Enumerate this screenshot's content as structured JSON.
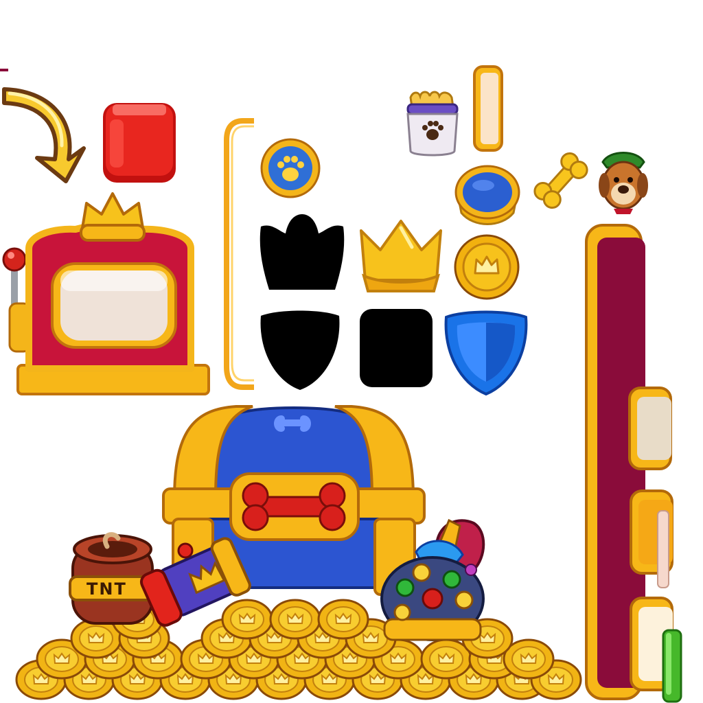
{
  "sheet": {
    "kind": "game-ui-sprite-atlas",
    "background": "#ffffff"
  },
  "sprites": [
    {
      "name": "curved-arrow-icon",
      "color": "#f7c92e"
    },
    {
      "name": "red-cube-icon",
      "color": "#e0201c"
    },
    {
      "name": "slot-machine-frame",
      "color": "#c8143a"
    },
    {
      "name": "paw-badge-icon",
      "color": "#2f6fd6"
    },
    {
      "name": "crown-mask-silhouette",
      "color": "#000000"
    },
    {
      "name": "shield-mask-silhouette",
      "color": "#000000"
    },
    {
      "name": "square-mask-silhouette",
      "color": "#000000"
    },
    {
      "name": "golden-crown-icon",
      "color": "#f5b812"
    },
    {
      "name": "blue-laurel-badge-icon",
      "color": "#2b5fd0"
    },
    {
      "name": "crown-coin-icon",
      "color": "#f2b10f"
    },
    {
      "name": "blue-shield-icon",
      "color": "#1a73e8"
    },
    {
      "name": "treat-jar-icon",
      "color": "#e9e4ee"
    },
    {
      "name": "dog-bone-icon",
      "color": "#f8c51d"
    },
    {
      "name": "dog-avatar-icon",
      "color": "#c9742c"
    },
    {
      "name": "treasure-chest-icon",
      "color": "#2c55d1"
    },
    {
      "name": "tnt-barrel-icon",
      "color": "#9a3420"
    },
    {
      "name": "rocket-booster-icon",
      "color": "#5040c0"
    },
    {
      "name": "jeweled-helmet-icon",
      "color": "#3a4880"
    },
    {
      "name": "coin-pile",
      "color": "#f1b414"
    },
    {
      "name": "tall-maroon-panel",
      "color": "#8a0c3a"
    },
    {
      "name": "green-bar",
      "color": "#46b82a"
    }
  ],
  "labels": {
    "barrel_text": "TNT"
  }
}
